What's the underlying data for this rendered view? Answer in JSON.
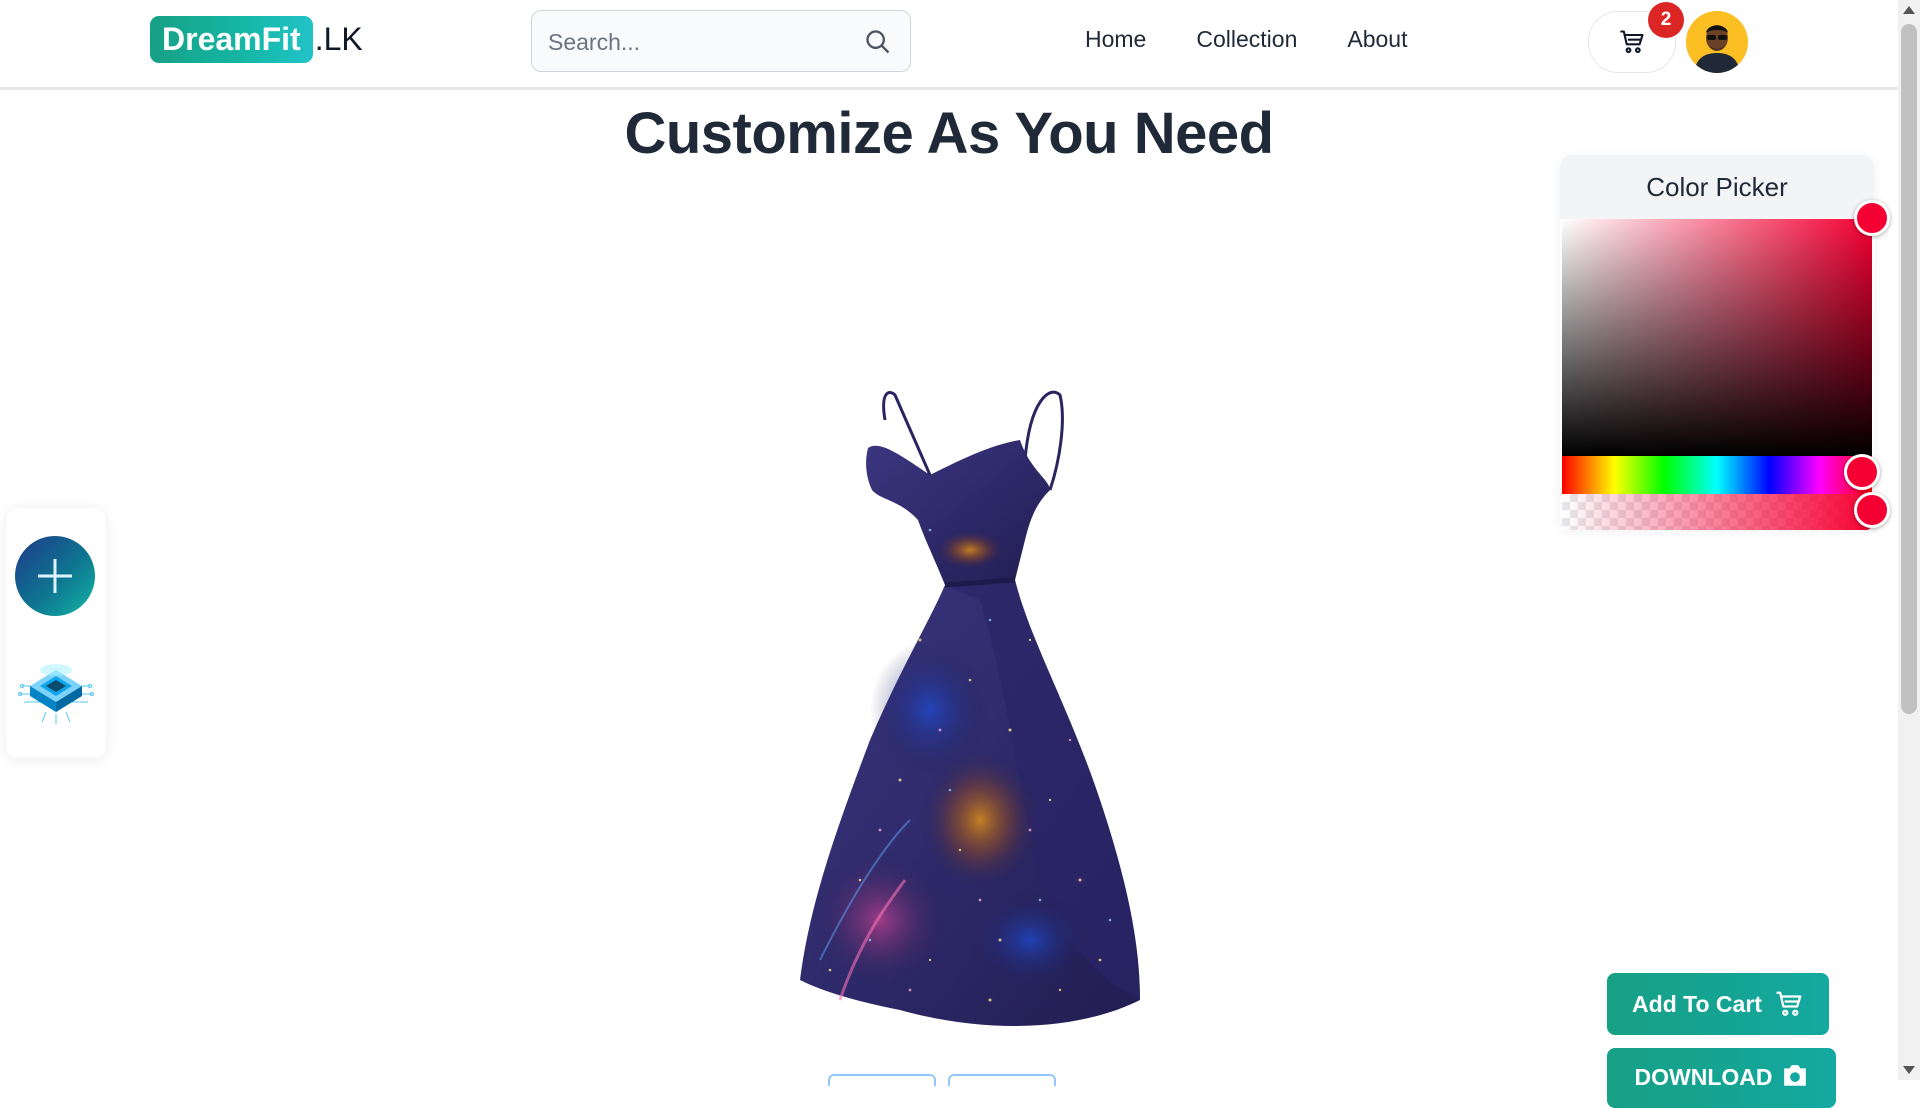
{
  "header": {
    "logo_main": "DreamFit",
    "logo_suffix": ".LK",
    "search_placeholder": "Search...",
    "nav": [
      "Home",
      "Collection",
      "About"
    ],
    "cart_count": "2"
  },
  "main": {
    "title": "Customize As You Need"
  },
  "color_picker": {
    "title": "Color Picker",
    "selected_color": "#f50032",
    "hue_level": 0.95,
    "alpha_level": 1.0
  },
  "actions": {
    "add_to_cart": "Add To Cart",
    "download": "DOWNLOAD"
  },
  "colors": {
    "brand_teal": "#16a085",
    "title_text": "#1f2937",
    "badge_red": "#dc2626"
  },
  "icons": [
    "search-icon",
    "cart-icon",
    "plus-icon",
    "ai-chip-icon",
    "camera-icon"
  ]
}
